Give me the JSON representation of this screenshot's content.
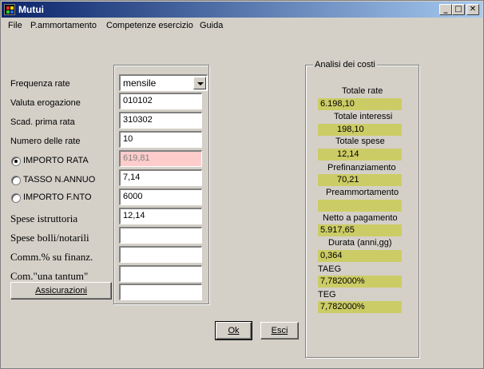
{
  "window": {
    "title": "Mutui",
    "min_symbol": "_",
    "max_symbol": "□",
    "close_symbol": "✕"
  },
  "menu": {
    "file": "File",
    "ammortamento": "P.ammortamento",
    "competenze": "Competenze esercizio",
    "guida": "Guida"
  },
  "form": {
    "frequenza_label": "Frequenza rate",
    "frequenza_value": "mensile",
    "valuta_label": "Valuta erogazione",
    "valuta_value": "010102",
    "scad_label": "Scad. prima rata",
    "scad_value": "310302",
    "numero_label": "Numero delle rate",
    "numero_value": "10",
    "importo_rata_label": "IMPORTO RATA",
    "importo_rata_value": "619,81",
    "tasso_label": "TASSO N.ANNUO",
    "tasso_value": "7,14",
    "importo_fnto_label": "IMPORTO F.NTO",
    "importo_fnto_value": "6000",
    "spese_istr_label": "Spese istruttoria",
    "spese_istr_value": "12,14",
    "spese_bolli_label": "Spese bolli/notarili",
    "spese_bolli_value": "",
    "comm_label": "Comm.% su finanz.",
    "comm_value": "",
    "com_tantum_label": "Com.\"una tantum\"",
    "com_tantum_value": "",
    "assicurazioni_label": "Assicurazioni",
    "assicurazioni_value": "",
    "selected_radio": "importo_rata"
  },
  "buttons": {
    "ok": "Ok",
    "esci": "Esci"
  },
  "analisi": {
    "title": "Analisi dei costi",
    "totale_rate_label": "Totale rate",
    "totale_rate_value": "6.198,10",
    "totale_interessi_label": "Totale interessi",
    "totale_interessi_value": "198,10",
    "totale_spese_label": "Totale spese",
    "totale_spese_value": "12,14",
    "prefinanziamento_label": "Prefinanziamento",
    "prefinanziamento_value": "70,21",
    "preammortamento_label": "Preammortamento",
    "preammortamento_value": "",
    "netto_label": "Netto a pagamento",
    "netto_value": "5.917,65",
    "durata_label": "Durata (anni,gg)",
    "durata_value": "0,364",
    "taeg_label": "TAEG",
    "taeg_value": "7,782000%",
    "teg_label": "TEG",
    "teg_value": "7,782000%"
  },
  "colors": {
    "window_bg": "#d4d0c8",
    "title_gradient_start": "#0a246a",
    "title_gradient_end": "#a6caf0",
    "highlight_field": "#ffcccc",
    "cost_value_bg": "#cccc66"
  }
}
